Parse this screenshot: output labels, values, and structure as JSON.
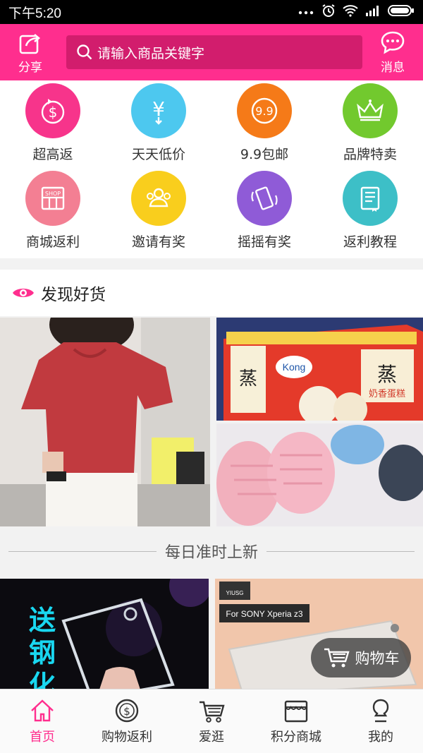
{
  "status_bar": {
    "time": "下午5:20"
  },
  "header": {
    "share_label": "分享",
    "search_placeholder": "请输入商品关键字",
    "messages_label": "消息"
  },
  "categories": [
    {
      "label": "超高返",
      "icon": "dollar-return-icon",
      "color": "#f7348b"
    },
    {
      "label": "天天低价",
      "icon": "yen-down-icon",
      "color": "#4dc8ef"
    },
    {
      "label": "9.9包邮",
      "icon": "nine-nine-icon",
      "color": "#f57a18"
    },
    {
      "label": "品牌特卖",
      "icon": "crown-icon",
      "color": "#72c92e"
    },
    {
      "label": "商城返利",
      "icon": "shop-icon",
      "color": "#f37f93"
    },
    {
      "label": "邀请有奖",
      "icon": "people-icon",
      "color": "#f9ce1d"
    },
    {
      "label": "摇摇有奖",
      "icon": "phone-shake-icon",
      "color": "#8f5bd7"
    },
    {
      "label": "返利教程",
      "icon": "book-icon",
      "color": "#3dbfc7"
    }
  ],
  "discover": {
    "title": "发现好货"
  },
  "products_top": [
    {
      "name": "red-tshirt-image"
    },
    {
      "name": "cake-box-image",
      "brand_text": "Kong",
      "box_text": "奶香蛋糕"
    },
    {
      "name": "slippers-image"
    }
  ],
  "daily": {
    "title": "每日准时上新"
  },
  "products_bottom": [
    {
      "name": "phone-case-image",
      "promo_text": "送钢化"
    },
    {
      "name": "sony-case-image",
      "brand_text": "YIUSG",
      "model_text": "For SONY Xperia z3"
    }
  ],
  "cart": {
    "label": "购物车"
  },
  "tabbar": [
    {
      "label": "首页",
      "icon": "home-icon",
      "active": true
    },
    {
      "label": "购物返利",
      "icon": "dollar-coin-icon",
      "active": false
    },
    {
      "label": "爱逛",
      "icon": "cart-icon",
      "active": false
    },
    {
      "label": "积分商城",
      "icon": "store-icon",
      "active": false
    },
    {
      "label": "我的",
      "icon": "user-icon",
      "active": false
    }
  ],
  "colors": {
    "brand": "#ff2e8e",
    "search_bg": "#d21d6d"
  }
}
